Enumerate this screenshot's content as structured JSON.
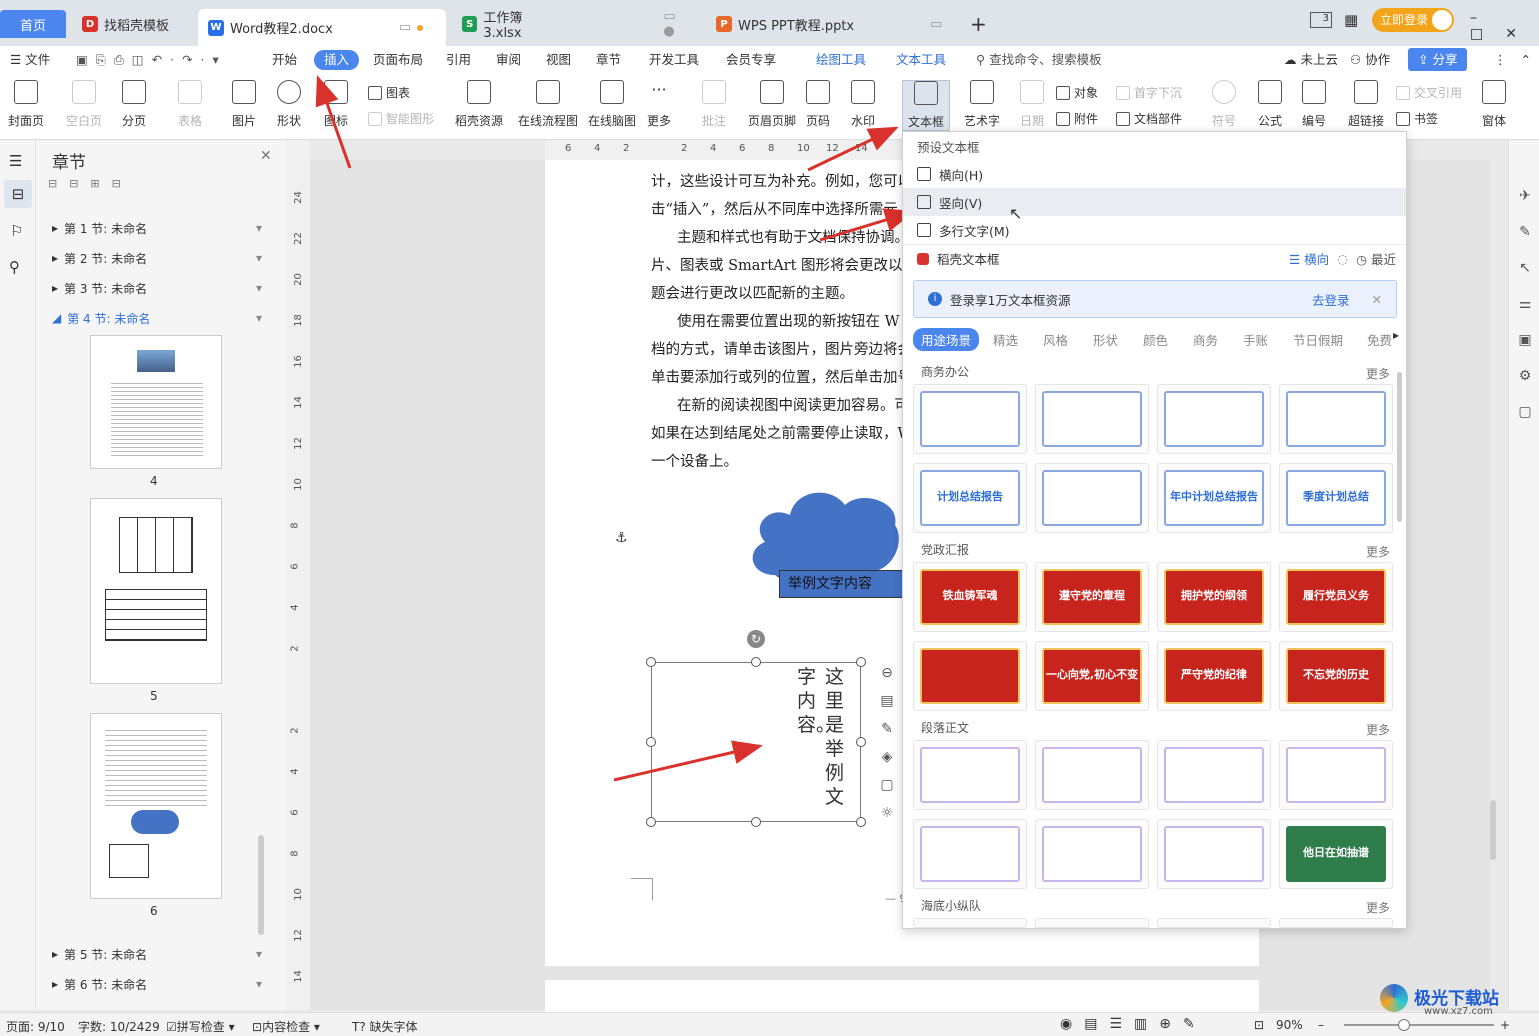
{
  "tabs": {
    "home": "首页",
    "find": "找稻壳模板",
    "doc": "Word教程2.docx",
    "sheet": "工作簿3.xlsx",
    "ppt": "WPS PPT教程.pptx",
    "new": "+",
    "login": "立即登录",
    "layout_badge": "3"
  },
  "menu": {
    "file": "文件",
    "start": "开始",
    "insert": "插入",
    "layout": "页面布局",
    "ref": "引用",
    "review": "审阅",
    "view": "视图",
    "chapter": "章节",
    "dev": "开发工具",
    "vip": "会员专享",
    "draw": "绘图工具",
    "text": "文本工具",
    "search": "查找命令、搜索模板",
    "cloud": "未上云",
    "collab": "协作",
    "share": "分享"
  },
  "ribbon": {
    "cover": "封面页",
    "blank": "空白页",
    "break": "分页",
    "table": "表格",
    "pic": "图片",
    "shape": "形状",
    "icon": "图标",
    "chart": "图表",
    "smart": "智能图形",
    "docer": "稻壳资源",
    "flow": "在线流程图",
    "mind": "在线脑图",
    "more": "更多",
    "comment": "批注",
    "header": "页眉页脚",
    "pagenum": "页码",
    "water": "水印",
    "textbox": "文本框",
    "art": "艺术字",
    "date": "日期",
    "obj": "对象",
    "attach": "附件",
    "drop": "首字下沉",
    "parts": "文档部件",
    "symbol": "符号",
    "formula": "公式",
    "num": "编号",
    "link": "超链接",
    "cross": "交叉引用",
    "bookmark": "书签",
    "window": "窗体"
  },
  "nav": {
    "title": "章节",
    "sections": [
      "第 1 节: 未命名",
      "第 2 节: 未命名",
      "第 3 节: 未命名",
      "第 4 节: 未命名",
      "第 5 节: 未命名",
      "第 6 节: 未命名"
    ],
    "pages": [
      "4",
      "5",
      "6"
    ]
  },
  "hruler": [
    "6",
    "4",
    "2",
    "",
    "2",
    "4",
    "6",
    "8",
    "10",
    "12",
    "14"
  ],
  "vruler": [
    "24",
    "22",
    "20",
    "18",
    "16",
    "14",
    "12",
    "10",
    "8",
    "6",
    "4",
    "2",
    "",
    "2",
    "4",
    "6",
    "8",
    "10",
    "12",
    "14"
  ],
  "doc": {
    "lines": [
      "计，这些设计可互为补充。例如，您可以",
      "击“插入”，然后从不同库中选择所需元",
      "主题和样式也有助于文档保持协调。",
      "片、图表或 SmartArt 图形将会更改以匹",
      "题会进行更改以匹配新的主题。",
      "使用在需要位置出现的新按钮在 W",
      "档的方式，请单击该图片，图片旁边将会",
      "单击要添加行或列的位置，然后单击加号",
      "在新的阅读视图中阅读更加容易。可",
      "如果在达到结尾处之前需要停止读取，W",
      "一个设备上。"
    ],
    "cloud_text": "举例文字内容",
    "vertical_col1": "这里是举例文",
    "vertical_col2": "字内容。",
    "page_footer": "— 9"
  },
  "dropdown": {
    "preset": "预设文本框",
    "h": "横向(H)",
    "v": "竖向(V)",
    "multi": "多行文字(M)",
    "docer": "稻壳文本框",
    "horiz": "横向",
    "recent": "最近",
    "banner": "登录享1万文本框资源",
    "banner_link": "去登录",
    "cats": [
      "用途场景",
      "精选",
      "风格",
      "形状",
      "颜色",
      "商务",
      "手账",
      "节日假期",
      "免费"
    ],
    "sec1": "商务办公",
    "sec2": "党政汇报",
    "sec3": "段落正文",
    "sec4": "海底小纵队",
    "more": "更多",
    "cards_biz": [
      "",
      "",
      "",
      "",
      "计划总结报告",
      "",
      "年中计划总结报告",
      "季度计划总结"
    ],
    "cards_party": [
      "铁血铸军魂",
      "遵守党的章程",
      "拥护党的纲领",
      "履行党员义务",
      "",
      "一心向党,初心不变",
      "严守党的纪律",
      "不忘党的历史"
    ],
    "cards_text": [
      "",
      "",
      "",
      "",
      "",
      "",
      "",
      "他日在如抽谱"
    ]
  },
  "status": {
    "page": "页面: 9/10",
    "words": "字数: 10/2429",
    "spell": "拼写检查",
    "content": "内容检查",
    "font": "缺失字体",
    "zoom": "90%"
  },
  "watermark": "极光下载站",
  "watermark_url": "www.xz7.com",
  "colors": {
    "accent": "#4a86ee",
    "red": "#d9312b",
    "cloud": "#4472c4"
  }
}
